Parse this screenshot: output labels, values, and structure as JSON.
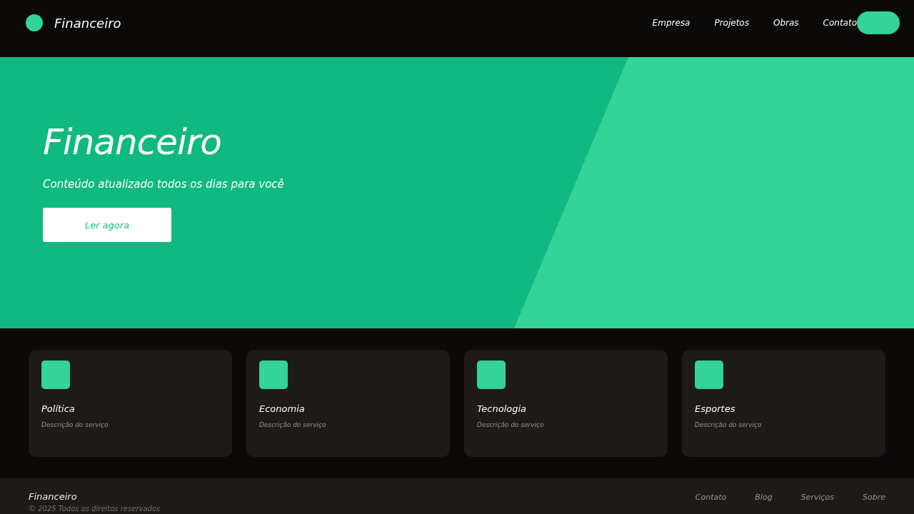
{
  "header": {
    "brand": "Financeiro",
    "nav": [
      {
        "label": "Empresa"
      },
      {
        "label": "Projetos"
      },
      {
        "label": "Obras"
      },
      {
        "label": "Contato"
      }
    ]
  },
  "hero": {
    "title": "Financeiro",
    "subtitle": "Conteúdo atualizado todos os dias para você",
    "button": "Ler agora"
  },
  "cards": [
    {
      "title": "Política",
      "description": "Descrição do serviço"
    },
    {
      "title": "Economia",
      "description": "Descrição do serviço"
    },
    {
      "title": "Tecnologia",
      "description": "Descrição do serviço"
    },
    {
      "title": "Esportes",
      "description": "Descrição do serviço"
    }
  ],
  "footer": {
    "brand": "Financeiro",
    "copyright": "© 2025 Todos os direitos reservados",
    "links": [
      {
        "label": "Contato"
      },
      {
        "label": "Blog"
      },
      {
        "label": "Serviços"
      },
      {
        "label": "Sobre"
      }
    ]
  }
}
